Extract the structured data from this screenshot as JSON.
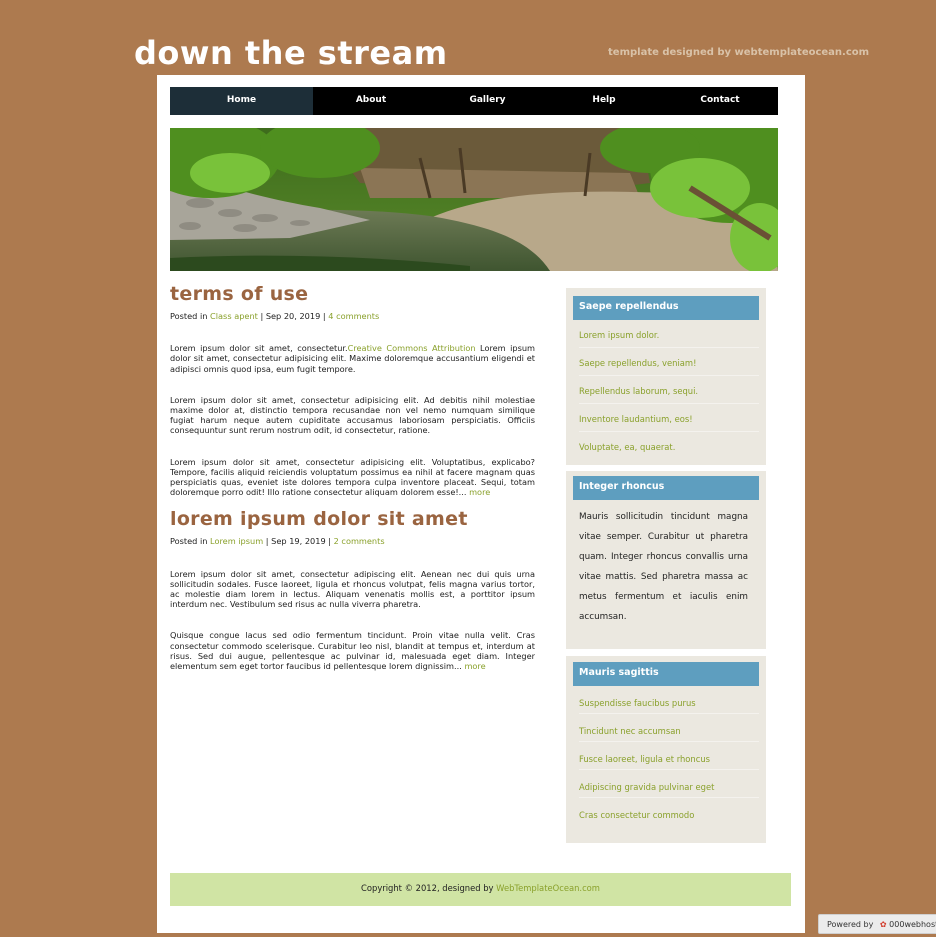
{
  "site": {
    "title": "down the stream",
    "tagline": "template designed by webtemplateocean.com"
  },
  "nav": [
    "Home",
    "About",
    "Gallery",
    "Help",
    "Contact"
  ],
  "posts": [
    {
      "title": "terms of use",
      "posted": "Posted in",
      "category": "Class apent",
      "date": "Sep 20, 2019",
      "comments": "4 comments",
      "p1_start": "Lorem ipsum dolor sit amet, consectetur.",
      "p1_link": "Creative Commons Attribution",
      "p1_end": " Lorem ipsum dolor sit amet, consectetur adipisicing elit. Maxime doloremque accusantium eligendi et adipisci omnis quod ipsa, eum fugit tempore.",
      "p2": "Lorem ipsum dolor sit amet, consectetur adipisicing elit. Ad debitis nihil molestiae maxime dolor at, distinctio tempora recusandae non vel nemo numquam similique fugiat harum neque autem cupiditate accusamus laboriosam perspiciatis. Officiis consequuntur sunt rerum nostrum odit, id consectetur, ratione.",
      "p3": "Lorem ipsum dolor sit amet, consectetur adipisicing elit. Voluptatibus, explicabo? Tempore, facilis aliquid reiciendis voluptatum possimus ea nihil at facere magnam quas perspiciatis quas, eveniet iste dolores tempora culpa inventore placeat. Sequi, totam doloremque porro odit! Illo ratione consectetur aliquam dolorem esse!...",
      "more": "more"
    },
    {
      "title": "lorem ipsum dolor sit amet",
      "posted": "Posted in",
      "category": "Lorem ipsum",
      "date": "Sep 19, 2019",
      "comments": "2 comments",
      "p1": "Lorem ipsum dolor sit amet, consectetur adipiscing elit. Aenean nec dui quis urna sollicitudin sodales. Fusce laoreet, ligula et rhoncus volutpat, felis magna varius tortor, ac molestie diam lorem in lectus. Aliquam venenatis mollis est, a porttitor ipsum interdum nec. Vestibulum sed risus ac nulla viverra pharetra.",
      "p2": "Quisque congue lacus sed odio fermentum tincidunt. Proin vitae nulla velit. Cras consectetur commodo scelerisque. Curabitur leo nisl, blandit at tempus et, interdum at risus. Sed dui augue, pellentesque ac pulvinar id, malesuada eget diam. Integer elementum sem eget tortor faucibus id pellentesque lorem dignissim...",
      "more": "more"
    }
  ],
  "sidebar": {
    "box1": {
      "title": "Saepe repellendus",
      "links": [
        "Lorem ipsum dolor.",
        "Saepe repellendus, veniam!",
        "Repellendus laborum, sequi.",
        "Inventore laudantium, eos!",
        "Voluptate, ea, quaerat."
      ]
    },
    "box2": {
      "title": "Integer rhoncus",
      "text": "Mauris sollicitudin tincidunt magna vitae semper. Curabitur ut pharetra quam. Integer rhoncus convallis urna vitae mattis. Sed pharetra massa ac metus fermentum et iaculis enim accumsan."
    },
    "box3": {
      "title": "Mauris sagittis",
      "links": [
        "Suspendisse faucibus purus",
        "Tincidunt nec accumsan",
        "Fusce laoreet, ligula et rhoncus",
        "Adipiscing gravida pulvinar eget",
        "Cras consectetur commodo"
      ]
    }
  },
  "footer": {
    "text": "Copyright © 2012, designed by",
    "link": "WebTemplateOcean.com"
  },
  "badge": {
    "powered": "Powered by",
    "brand": "000webhost"
  },
  "colors": {
    "background": "#ad7a4f",
    "nav_active": "#1d2e38",
    "link_green": "#8aa12c",
    "post_title": "#9a6440",
    "sidebar_head": "#5e9ebf",
    "footer_bg": "#d0e4a4"
  }
}
